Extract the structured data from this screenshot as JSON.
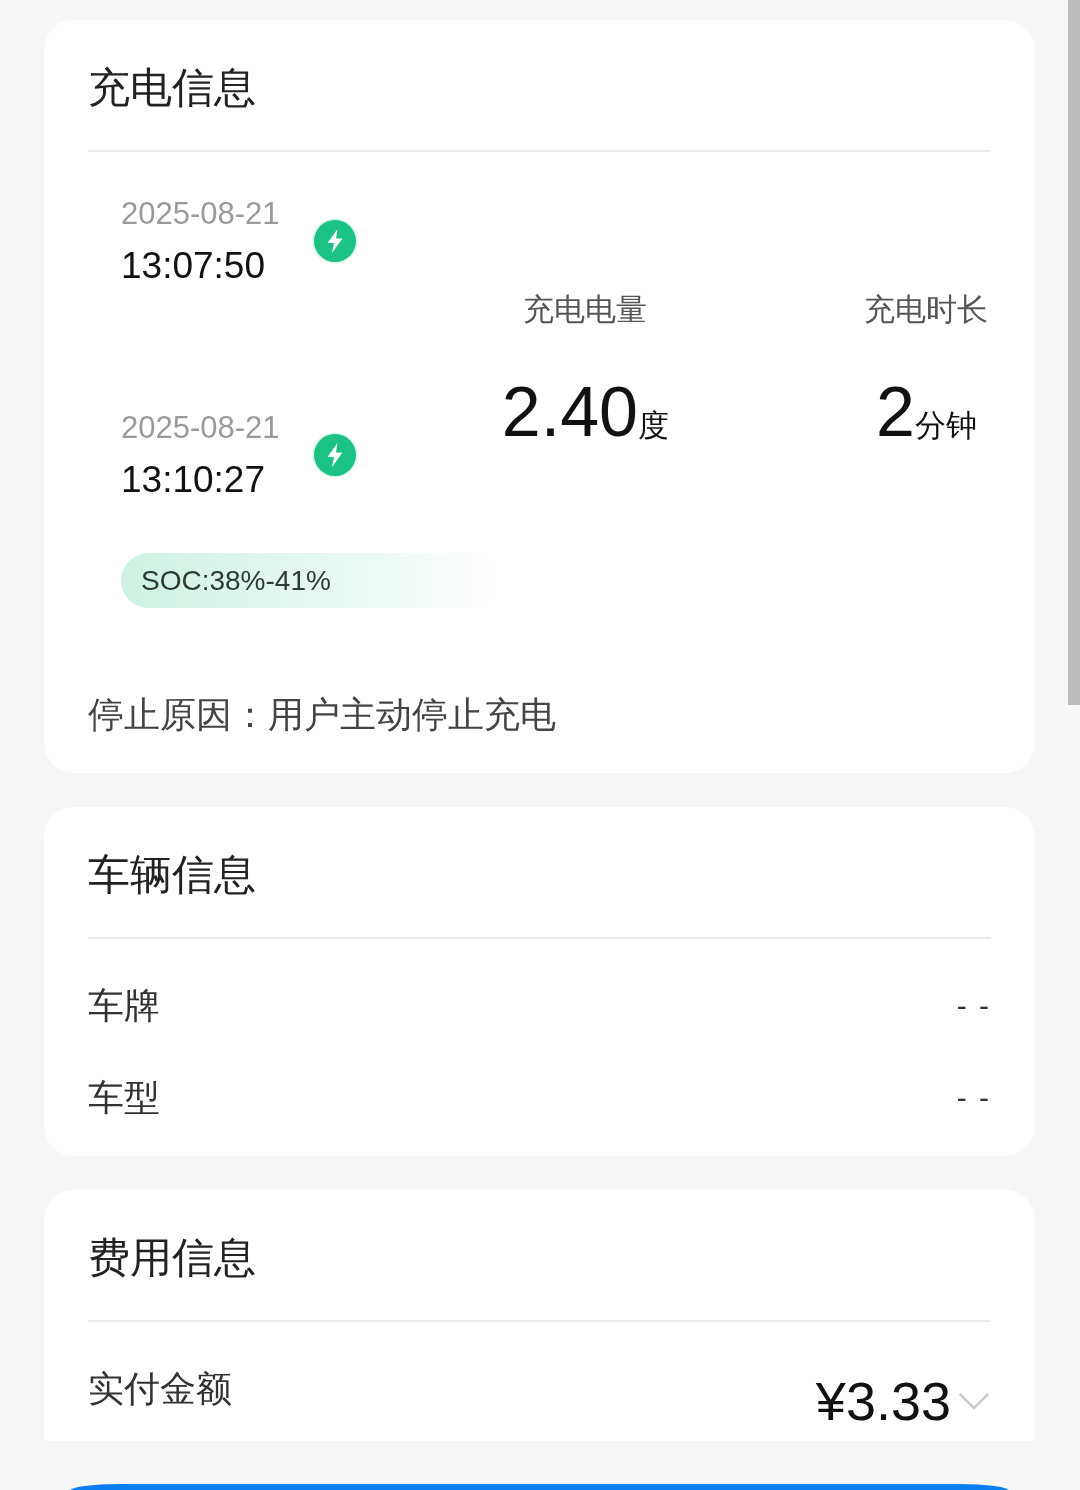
{
  "charging_info": {
    "title": "充电信息",
    "events": [
      {
        "date": "2025-08-21",
        "time": "13:07:50"
      },
      {
        "date": "2025-08-21",
        "time": "13:10:27"
      }
    ],
    "stats": [
      {
        "label": "充电电量",
        "value": "2.40",
        "unit": "度"
      },
      {
        "label": "充电时长",
        "value": "2",
        "unit": "分钟"
      }
    ],
    "soc": "SOC:38%-41%",
    "stop_reason": "停止原因：用户主动停止充电"
  },
  "vehicle_info": {
    "title": "车辆信息",
    "rows": [
      {
        "label": "车牌",
        "value": "- -"
      },
      {
        "label": "车型",
        "value": "- -"
      }
    ]
  },
  "cost_info": {
    "title": "费用信息",
    "rows": [
      {
        "label": "实付金额",
        "value": "¥3.33",
        "expanded": false
      }
    ]
  }
}
